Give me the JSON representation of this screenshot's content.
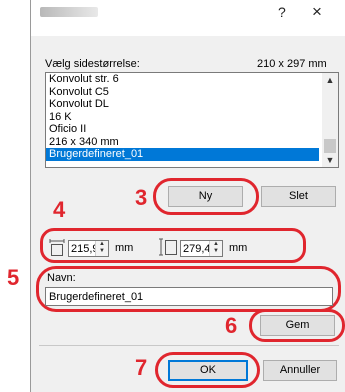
{
  "window": {
    "help_label": "?",
    "close_label": "×"
  },
  "paper_size": {
    "label": "Vælg sidestørrelse:",
    "current_value": "210 x 297 mm",
    "items": [
      {
        "label": "Konvolut str. 6",
        "selected": false
      },
      {
        "label": "Konvolut C5",
        "selected": false
      },
      {
        "label": "Konvolut DL",
        "selected": false
      },
      {
        "label": "16 K",
        "selected": false
      },
      {
        "label": "Oficio II",
        "selected": false
      },
      {
        "label": "216 x 340 mm",
        "selected": false
      },
      {
        "label": "Brugerdefineret_01",
        "selected": true
      }
    ]
  },
  "buttons": {
    "new_label": "Ny",
    "delete_label": "Slet",
    "save_label": "Gem",
    "ok_label": "OK",
    "cancel_label": "Annuller"
  },
  "dimensions": {
    "width_value": "215,9",
    "width_unit": "mm",
    "height_value": "279,4",
    "height_unit": "mm"
  },
  "name_field": {
    "label": "Navn:",
    "value": "Brugerdefineret_01"
  },
  "steps": {
    "step3": "3",
    "step4": "4",
    "step5": "5",
    "step6": "6",
    "step7": "7"
  },
  "colors": {
    "annotation": "#e0262e",
    "selection": "#0078d7"
  }
}
